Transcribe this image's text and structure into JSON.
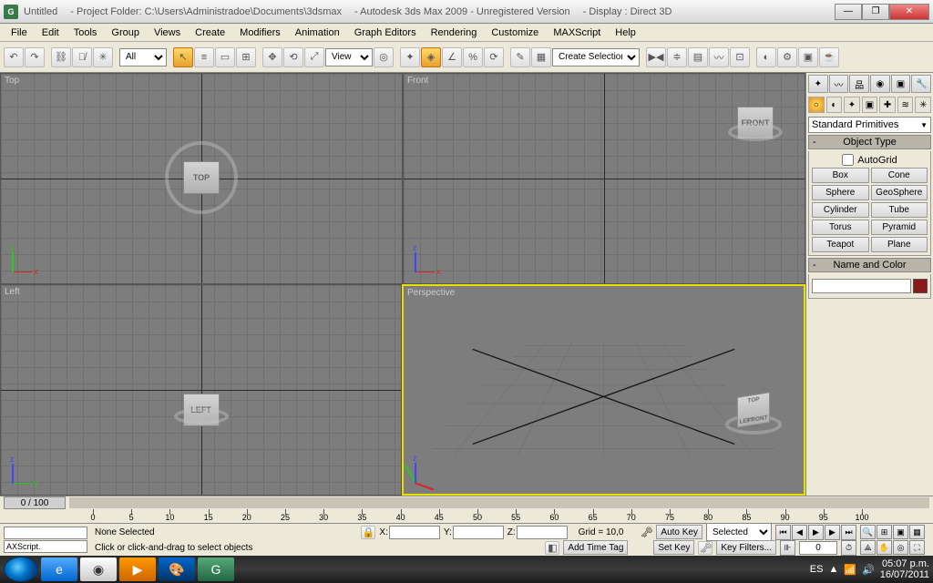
{
  "title": {
    "doc": "Untitled",
    "folder": "- Project Folder: C:\\Users\\Administradoe\\Documents\\3dsmax",
    "app": "- Autodesk 3ds Max  2009  - Unregistered Version",
    "display": "- Display : Direct 3D"
  },
  "winbtns": {
    "min": "—",
    "max": "❐",
    "close": "✕"
  },
  "menu": [
    "File",
    "Edit",
    "Tools",
    "Group",
    "Views",
    "Create",
    "Modifiers",
    "Animation",
    "Graph Editors",
    "Rendering",
    "Customize",
    "MAXScript",
    "Help"
  ],
  "toolbar": {
    "filter_label": "All",
    "view_label": "View",
    "selset_label": "Create Selection Set"
  },
  "viewports": {
    "top": "Top",
    "front": "Front",
    "left": "Left",
    "persp": "Perspective"
  },
  "viewcube": {
    "top": "TOP",
    "front": "FRONT",
    "left": "LEFT"
  },
  "axes": {
    "x": "x",
    "y": "y",
    "z": "z"
  },
  "cmd": {
    "dd": "Standard Primitives",
    "obj_hdr": "Object Type",
    "autogrid": "AutoGrid",
    "objs": [
      "Box",
      "Cone",
      "Sphere",
      "GeoSphere",
      "Cylinder",
      "Tube",
      "Torus",
      "Pyramid",
      "Teapot",
      "Plane"
    ],
    "name_hdr": "Name and Color"
  },
  "time": {
    "frame": "0 / 100",
    "ticks": [
      0,
      5,
      10,
      15,
      20,
      25,
      30,
      35,
      40,
      45,
      50,
      55,
      60,
      65,
      70,
      75,
      80,
      85,
      90,
      95,
      100
    ]
  },
  "status": {
    "script": "AXScript.",
    "sel": "None Selected",
    "hint": "Click or click-and-drag to select objects",
    "x": "X:",
    "y": "Y:",
    "z": "Z:",
    "grid": "Grid = 10,0",
    "addtag": "Add Time Tag",
    "autokey": "Auto Key",
    "setkey": "Set Key",
    "selected": "Selected",
    "keyfilters": "Key Filters...",
    "frame0": "0"
  },
  "tray": {
    "lang": "ES",
    "time": "05:07 p.m.",
    "date": "16/07/2011"
  }
}
